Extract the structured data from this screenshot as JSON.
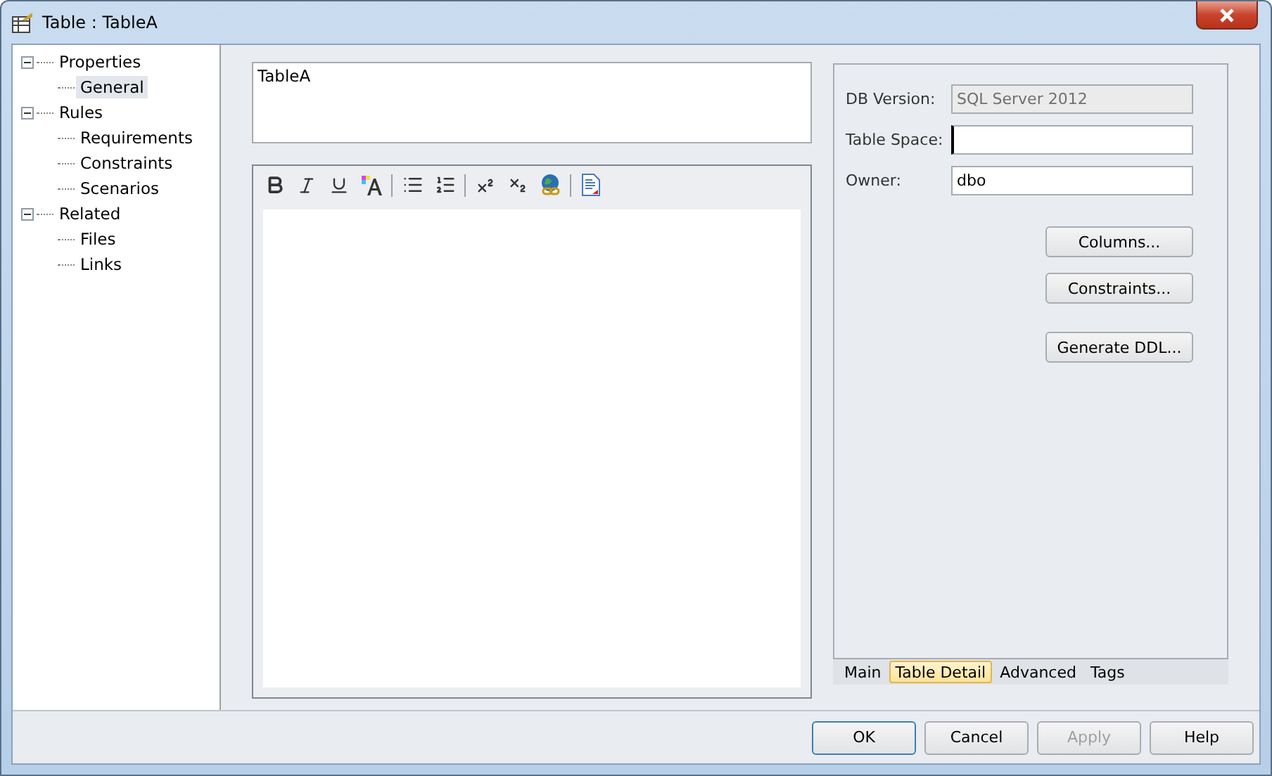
{
  "window": {
    "title": "Table : TableA"
  },
  "tree": [
    {
      "label": "Properties",
      "expanded": true,
      "selected": false,
      "children": [
        {
          "label": "General",
          "selected": true
        }
      ]
    },
    {
      "label": "Rules",
      "expanded": true,
      "selected": false,
      "children": [
        {
          "label": "Requirements",
          "selected": false
        },
        {
          "label": "Constraints",
          "selected": false
        },
        {
          "label": "Scenarios",
          "selected": false
        }
      ]
    },
    {
      "label": "Related",
      "expanded": true,
      "selected": false,
      "children": [
        {
          "label": "Files",
          "selected": false
        },
        {
          "label": "Links",
          "selected": false
        }
      ]
    }
  ],
  "name_field": {
    "value": "TableA"
  },
  "notes_toolbar": [
    {
      "kind": "bold"
    },
    {
      "kind": "italic"
    },
    {
      "kind": "underline"
    },
    {
      "kind": "font-color"
    },
    {
      "kind": "separator"
    },
    {
      "kind": "bullets"
    },
    {
      "kind": "numbering"
    },
    {
      "kind": "separator"
    },
    {
      "kind": "superscript"
    },
    {
      "kind": "subscript"
    },
    {
      "kind": "hyperlink"
    },
    {
      "kind": "separator"
    },
    {
      "kind": "document"
    }
  ],
  "fields": [
    {
      "label": "DB Version:",
      "value": "SQL Server 2012",
      "disabled": true,
      "focused": false
    },
    {
      "label": "Table Space:",
      "disabled": false,
      "focused": true
    },
    {
      "label": "Owner:",
      "value": "dbo",
      "disabled": false,
      "focused": false
    }
  ],
  "action_buttons": [
    {
      "label": "Columns..."
    },
    {
      "label": "Constraints..."
    },
    {
      "label": "Generate DDL..."
    }
  ],
  "tabs": [
    {
      "label": "Main",
      "selected": false
    },
    {
      "label": "Table Detail",
      "selected": true
    },
    {
      "label": "Advanced",
      "selected": false
    },
    {
      "label": "Tags",
      "selected": false
    }
  ],
  "buttons": [
    {
      "label": "OK",
      "disabled": false,
      "default": true
    },
    {
      "label": "Cancel",
      "disabled": false,
      "default": false
    },
    {
      "label": "Apply",
      "disabled": true,
      "default": false
    },
    {
      "label": "Help",
      "disabled": false,
      "default": false
    }
  ]
}
